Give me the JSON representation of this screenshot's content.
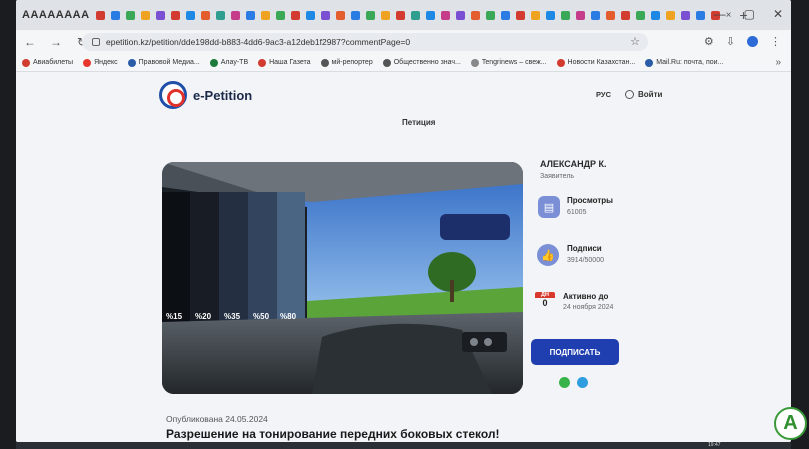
{
  "browser": {
    "tab_title": "AAAAAAAA",
    "tab_close": "×",
    "tab_favicon_colors": [
      "#d23b2f",
      "#2a7be4",
      "#3aa857",
      "#f0a321",
      "#7b4fd1",
      "#d23b2f",
      "#1e88e5",
      "#e35d2f",
      "#2f9e8f",
      "#c53c8a",
      "#2a7be4",
      "#f0a321",
      "#3aa857",
      "#d23b2f",
      "#1e88e5",
      "#7b4fd1",
      "#e35d2f",
      "#2a7be4",
      "#3aa857",
      "#f0a321",
      "#d23b2f",
      "#2f9e8f",
      "#1e88e5",
      "#c53c8a",
      "#7b4fd1",
      "#e35d2f",
      "#3aa857",
      "#2a7be4",
      "#d23b2f",
      "#f0a321",
      "#1e88e5",
      "#3aa857",
      "#c53c8a",
      "#2a7be4",
      "#e35d2f",
      "#d23b2f",
      "#3aa857",
      "#1e88e5",
      "#f0a321",
      "#7b4fd1",
      "#2a7be4",
      "#d23b2f"
    ],
    "new_tab": "+",
    "window_controls": [
      "—",
      "▢",
      "✕"
    ],
    "nav": {
      "back": "←",
      "forward": "→",
      "reload": "↻"
    },
    "url": "epetition.kz/petition/dde198dd-b883-4dd6-9ac3-a12deb1f2987?commentPage=0",
    "star": "☆",
    "toolbar_icons": [
      "⚙",
      "⇩",
      "⋮"
    ],
    "bookmarks": [
      {
        "label": "Авиабилеты",
        "color": "#d23b2f"
      },
      {
        "label": "Яндекс",
        "color": "#e8382e"
      },
      {
        "label": "Правовой Медиа...",
        "color": "#2a5ca8"
      },
      {
        "label": "Алау-ТВ",
        "color": "#1d7a3a"
      },
      {
        "label": "Наша Газета",
        "color": "#d23b2f"
      },
      {
        "label": "мй-репортер",
        "color": "#555555"
      },
      {
        "label": "Общественно знач...",
        "color": "#555555"
      },
      {
        "label": "Tengrinews – свеж...",
        "color": "#888888"
      },
      {
        "label": "Новости Казахстан...",
        "color": "#d23b2f"
      },
      {
        "label": "Mail.Ru: почта, пои...",
        "color": "#2a5ca8"
      }
    ],
    "bookmarks_more": "»"
  },
  "site": {
    "logo_text": "e-Petition",
    "lang": "РУС",
    "login": "Войти",
    "page_tab": "Петиция"
  },
  "hero_tint_labels": [
    "%15",
    "%20",
    "%35",
    "%50",
    "%80"
  ],
  "petition": {
    "published": "Опубликована 24.05.2024",
    "title": "Разрешение на тонирование передних боковых стекол!"
  },
  "author": {
    "name": "АЛЕКСАНДР К.",
    "role": "Заявитель"
  },
  "stats": {
    "views_label": "Просмотры",
    "views_value": "61005",
    "signatures_label": "Подписи",
    "signatures_value": "3914/50000",
    "days_head": "ДН",
    "days_value": "0",
    "active_label": "Активно до",
    "active_value": "24 ноября 2024"
  },
  "sign_button": "ПОДПИСАТЬ",
  "share_colors": {
    "whatsapp": "#38b34a",
    "telegram": "#2e9ee0"
  },
  "taskbar": {
    "clock": "19:47"
  },
  "channel_logo": "А",
  "colors": {
    "brand_blue": "#1f3fb0",
    "accent_red": "#d9382f",
    "icon_blue": "#7a8fd6"
  }
}
